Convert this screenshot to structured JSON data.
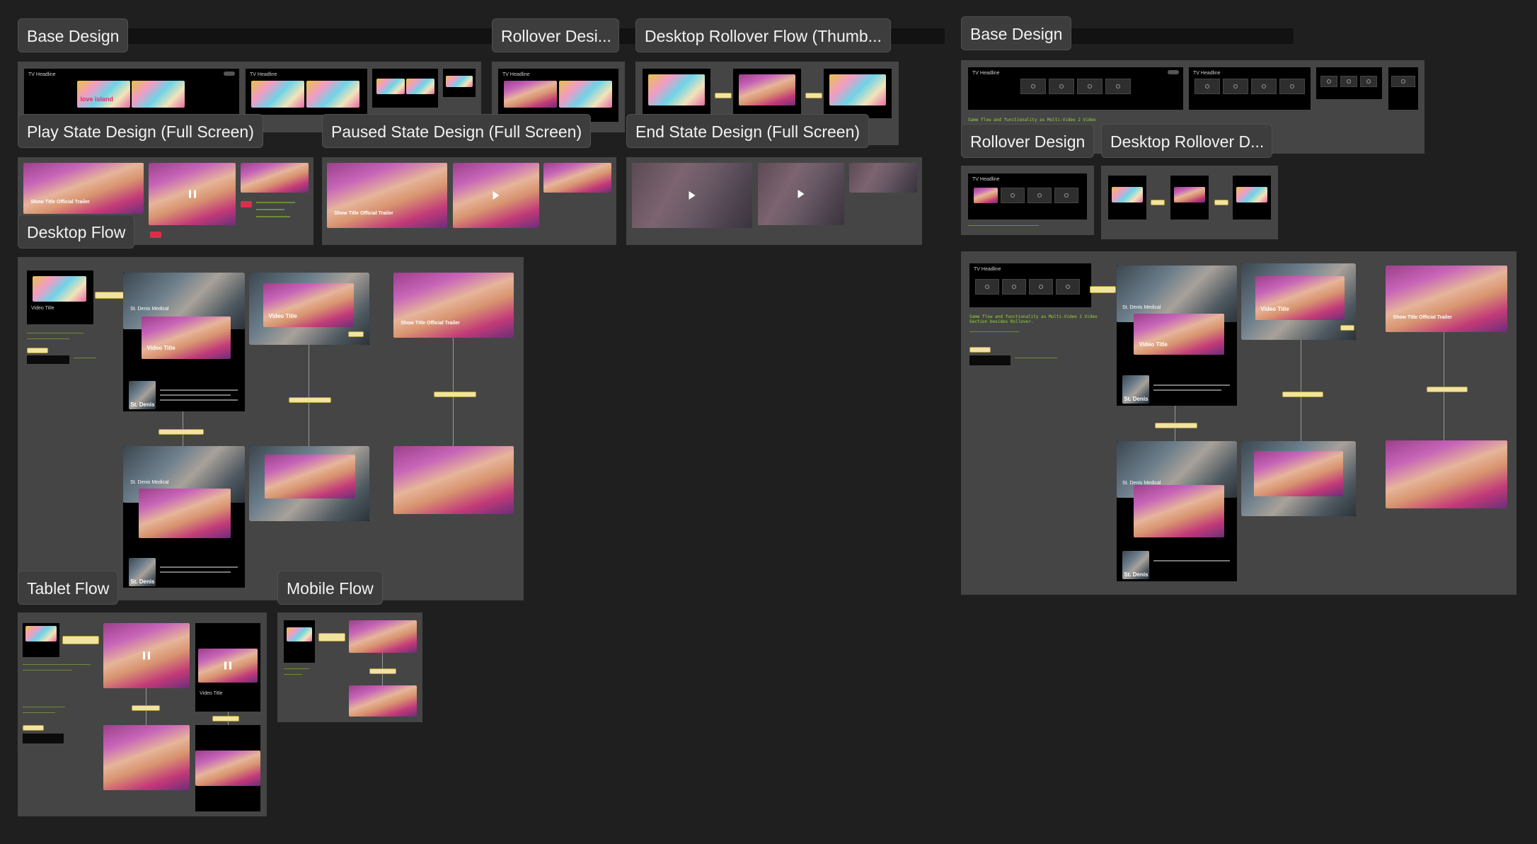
{
  "labels": {
    "base_design": "Base Design",
    "rollover_design_trunc": "Rollover Desi...",
    "desktop_rollover_flow": "Desktop Rollover Flow (Thumb...",
    "base_design_right": "Base Design",
    "play_state": "Play State Design (Full Screen)",
    "paused_state": "Paused State Design (Full Screen)",
    "end_state": "End State Design (Full Screen)",
    "rollover_design_right": "Rollover Design",
    "desktop_rollover_d": "Desktop Rollover D...",
    "desktop_flow": "Desktop Flow",
    "tablet_flow": "Tablet Flow",
    "mobile_flow": "Mobile Flow"
  },
  "frames": {
    "headline": "TV Headline",
    "video_title": "Video Title",
    "trailer_title": "Show Title Official Trailer",
    "doc_title": "St. Denis Medical",
    "poster_caption": "St. Denis",
    "logo_text": "love island"
  },
  "notes": {
    "same_flow": "Same flow and functionality as Multi-Video 2 Video",
    "same_flow_2": "Section besides Rollover."
  },
  "colors": {
    "canvas": "#1f1f1f",
    "section": "#454545",
    "label_bg": "#3d3d3d",
    "note_green": "#9bd63a",
    "sticky": "#f1e3a0",
    "cta_red": "#d8304a"
  }
}
